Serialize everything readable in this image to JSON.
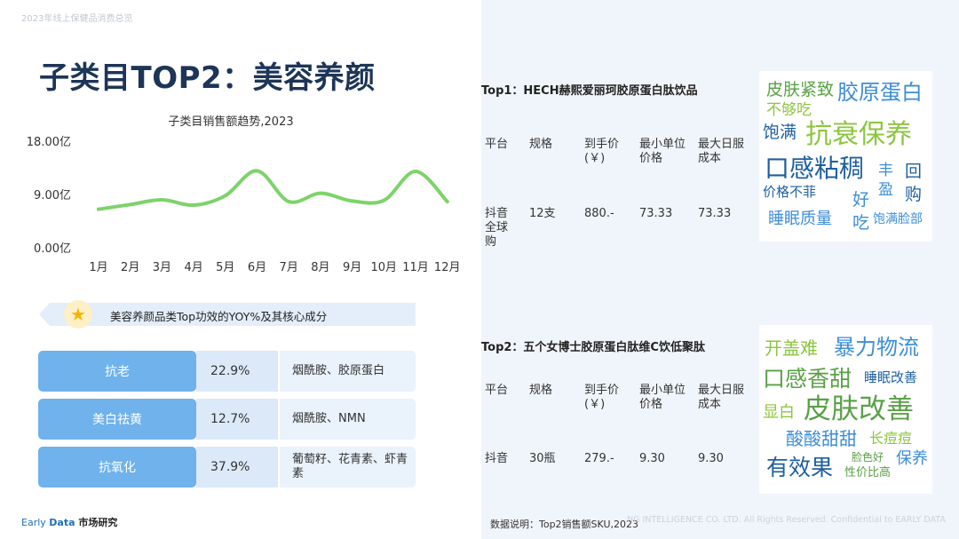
{
  "header": {
    "report_name": "2023年线上保健品消费总览"
  },
  "page_title": "子类目TOP2：美容养颜",
  "chart_data": {
    "type": "line",
    "title": "子类目销售额趋势,2023",
    "categories": [
      "1月",
      "2月",
      "3月",
      "4月",
      "5月",
      "6月",
      "7月",
      "8月",
      "9月",
      "10月",
      "11月",
      "12月"
    ],
    "values": [
      6.5,
      7.3,
      8.1,
      7.2,
      8.8,
      13.0,
      7.8,
      9.2,
      7.9,
      8.0,
      12.9,
      7.8
    ],
    "ylim": [
      0,
      18
    ],
    "yticks": [
      "18.00亿",
      "9.00亿",
      "0.00亿"
    ],
    "color": "#7dd36a"
  },
  "efficacy": {
    "title": "美容养颜品类Top功效的YOY%及其核心成分",
    "rows": [
      {
        "name": "抗老",
        "yoy": "22.9%",
        "ingredients": "烟酰胺、胶原蛋白"
      },
      {
        "name": "美白祛黄",
        "yoy": "12.7%",
        "ingredients": "烟酰胺、NMN"
      },
      {
        "name": "抗氧化",
        "yoy": "37.9%",
        "ingredients": "葡萄籽、花青素、虾青素"
      }
    ]
  },
  "products": [
    {
      "title": "Top1：HECH赫熙爱丽珂胶原蛋白肽饮品",
      "headers": [
        "平台",
        "规格",
        "到手价(￥)",
        "最小单位价格",
        "最大日服成本"
      ],
      "row": [
        "抖音全球购",
        "12支",
        "880.-",
        "73.33",
        "73.33"
      ],
      "cloud": [
        "皮肤紧致",
        "胶原蛋白",
        "不够吃",
        "饱满",
        "抗衰保养",
        "口感粘稠",
        "丰",
        "盈",
        "回购",
        "价格不菲",
        "好吃",
        "睡眠质量",
        "饱满脸部"
      ]
    },
    {
      "title": "Top2：五个女博士胶原蛋白肽维C饮低聚肽",
      "headers": [
        "平台",
        "规格",
        "到手价(￥)",
        "最小单位价格",
        "最大日服成本"
      ],
      "row": [
        "抖音",
        "30瓶",
        "279.-",
        "9.30",
        "9.30"
      ],
      "cloud": [
        "开盖难",
        "暴力物流",
        "口感香甜",
        "睡眠改善",
        "显白",
        "皮肤改善",
        "酸酸甜甜",
        "长痘痘",
        "脸色好",
        "有效果",
        "性价比高",
        "保养"
      ]
    }
  ],
  "footer": {
    "brand_part1": "Early ",
    "brand_part2": "Data",
    "brand_part3": " 市场研究",
    "note": "数据说明：Top2销售额SKU,2023",
    "copyright": "NG INTELLIGENCE CO. LTD. All Rights Reserved. Confidential to EARLY DATA"
  },
  "colors": {
    "title": "#1d3557",
    "efficacy_name_bg": "#6fb2ec",
    "cloud_green": "#5aa046",
    "cloud_light_green": "#8cc63f",
    "cloud_blue": "#3d8dd8",
    "cloud_dark_blue": "#1f5f9e"
  }
}
